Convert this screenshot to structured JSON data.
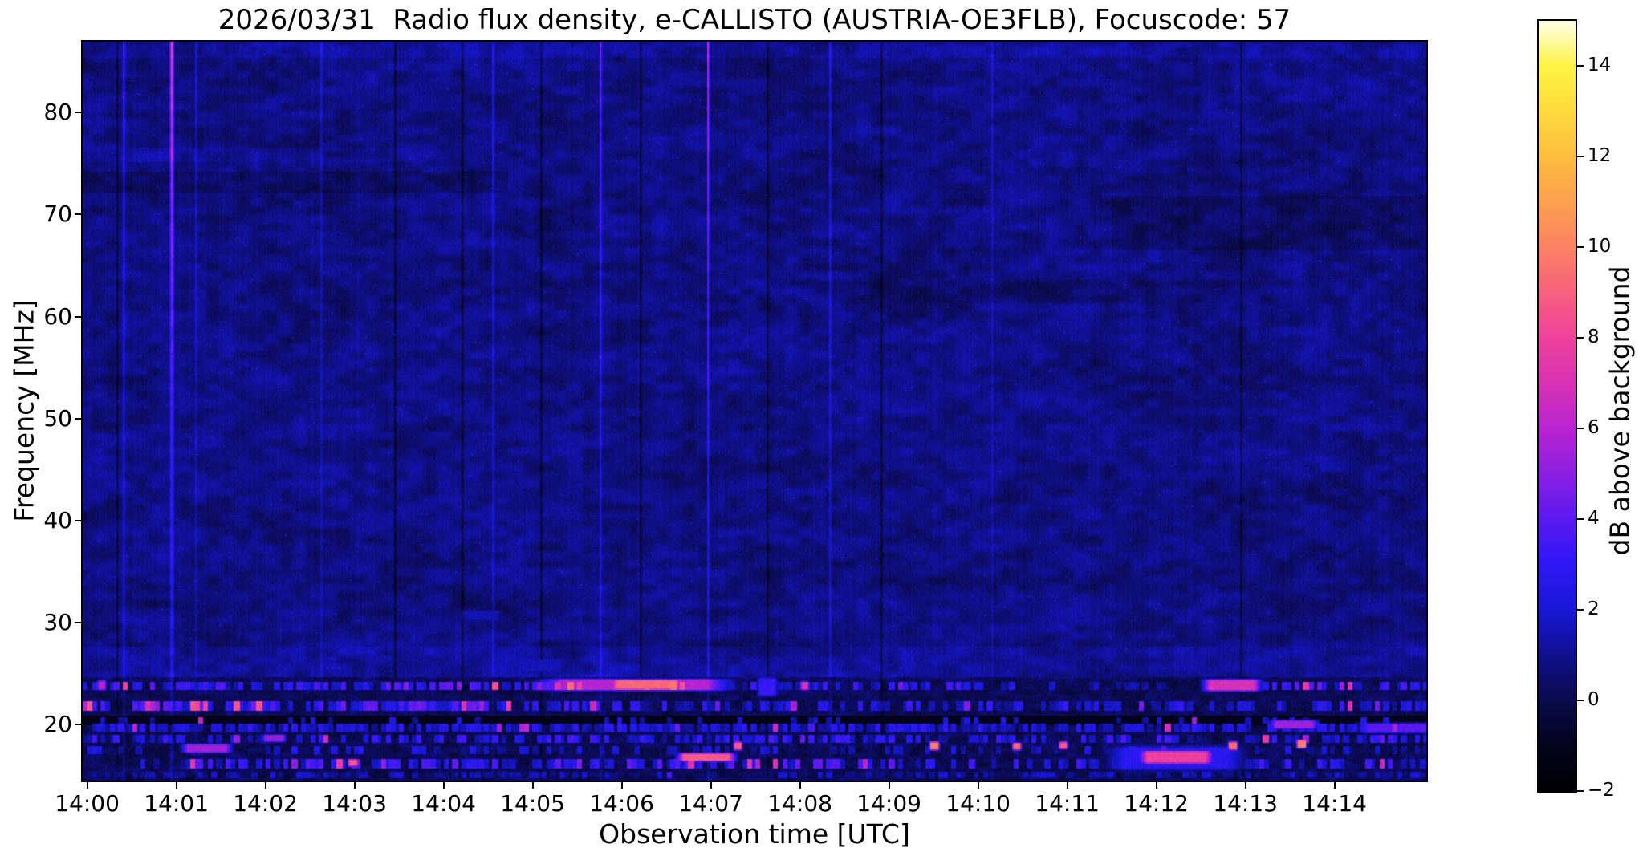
{
  "chart_data": {
    "type": "heatmap",
    "title": "2026/03/31  Radio flux density, e-CALLISTO (AUSTRIA-OE3FLB), Focuscode: 57",
    "xlabel": "Observation time [UTC]",
    "ylabel": "Frequency [MHz]",
    "colorbar_label": "dB above background",
    "x_tick_labels": [
      "14:00",
      "14:01",
      "14:02",
      "14:03",
      "14:04",
      "14:05",
      "14:06",
      "14:07",
      "14:08",
      "14:09",
      "14:10",
      "14:11",
      "14:12",
      "14:13",
      "14:14"
    ],
    "x_tick_minutes": [
      0,
      1,
      2,
      3,
      4,
      5,
      6,
      7,
      8,
      9,
      10,
      11,
      12,
      13,
      14
    ],
    "x_range_minutes": [
      -0.05,
      15.03
    ],
    "y_ticks_mhz": [
      80,
      70,
      60,
      50,
      40,
      30,
      20
    ],
    "y_range_mhz": [
      14.5,
      86.95
    ],
    "grid": false,
    "colorbar": {
      "ticks": [
        14,
        12,
        10,
        8,
        6,
        4,
        2,
        0,
        -2
      ],
      "range": [
        -2,
        15
      ],
      "stops": [
        [
          -2,
          "#000000"
        ],
        [
          -1,
          "#03031d"
        ],
        [
          0,
          "#0a0a4a"
        ],
        [
          1,
          "#10108e"
        ],
        [
          2,
          "#1717d6"
        ],
        [
          3,
          "#2e18f5"
        ],
        [
          4,
          "#5a19f0"
        ],
        [
          5,
          "#8a1fe2"
        ],
        [
          6,
          "#b724cf"
        ],
        [
          7,
          "#d832b4"
        ],
        [
          8,
          "#ef419c"
        ],
        [
          9,
          "#f7617e"
        ],
        [
          10,
          "#fb8163"
        ],
        [
          11,
          "#fca04e"
        ],
        [
          12,
          "#fdbd3e"
        ],
        [
          13,
          "#fdda3d"
        ],
        [
          14,
          "#fdf442"
        ],
        [
          15,
          "#ffffe8"
        ]
      ]
    },
    "background": {
      "base_db": 0.82,
      "low_band_top_mhz": 24.6,
      "low_base_db": 0.18
    },
    "stripes": [
      {
        "t0": -0.05,
        "t1": 15.03,
        "f0": 85.6,
        "f1": 86.95,
        "dv": 0.35
      },
      {
        "t0": -0.05,
        "t1": 4.7,
        "f0": 72.3,
        "f1": 74.2,
        "dv": -0.45
      },
      {
        "t0": -0.05,
        "t1": 3.6,
        "f0": 75.3,
        "f1": 76.6,
        "dv": 0.3
      },
      {
        "t0": 11.5,
        "t1": 15.03,
        "f0": 66.6,
        "f1": 71.9,
        "dv": -0.4
      },
      {
        "t0": 8.0,
        "t1": 15.03,
        "f0": 61.5,
        "f1": 63.5,
        "dv": -0.22
      },
      {
        "t0": -0.05,
        "t1": 15.03,
        "f0": 24.6,
        "f1": 27.6,
        "dv": 0.3
      }
    ],
    "vertical_streaks": [
      {
        "t": 0.4,
        "w": 2,
        "top": 2.6,
        "bot": 1.3
      },
      {
        "t": 0.94,
        "w": 3,
        "top": 7.2,
        "bot": 1.8
      },
      {
        "t": 1.22,
        "w": 2,
        "top": 1.5,
        "bot": 0.8
      },
      {
        "t": 2.62,
        "w": 2,
        "top": 1.3,
        "bot": 0.7
      },
      {
        "t": 4.55,
        "w": 2,
        "top": 1.6,
        "bot": 0.8
      },
      {
        "t": 5.75,
        "w": 2,
        "top": 3.6,
        "bot": 1.5
      },
      {
        "t": 6.95,
        "w": 2,
        "top": 5.2,
        "bot": 1.6
      },
      {
        "t": 8.32,
        "w": 2,
        "top": 1.7,
        "bot": 0.9
      },
      {
        "t": 10.15,
        "w": 2,
        "top": 1.2,
        "bot": 0.7
      }
    ],
    "dark_vertical_lines": [
      {
        "t": 0.32
      },
      {
        "t": 3.45
      },
      {
        "t": 4.2
      },
      {
        "t": 5.08
      },
      {
        "t": 6.2
      },
      {
        "t": 7.62
      },
      {
        "t": 8.9
      },
      {
        "t": 12.94
      }
    ],
    "band_rows": [
      {
        "f": 23.85,
        "h": 9,
        "segs": [
          [
            -0.05,
            5.0,
            0.6,
            1.5,
            4.2,
            0.08
          ],
          [
            5.0,
            6.9,
            0.85,
            2.5,
            5.5,
            0.3
          ],
          [
            6.9,
            9.9,
            0.5,
            1.2,
            3.6,
            0.05
          ],
          [
            9.9,
            12.45,
            0.28,
            0.8,
            2.8,
            0.03
          ],
          [
            12.45,
            15.03,
            0.6,
            1.5,
            4.2,
            0.12
          ]
        ]
      },
      {
        "f": 21.9,
        "h": 9,
        "segs": [
          [
            -0.05,
            4.7,
            0.85,
            1.8,
            4.6,
            0.18
          ],
          [
            4.7,
            15.03,
            0.5,
            1.0,
            3.2,
            0.06
          ]
        ]
      },
      {
        "f": 20.5,
        "h": 9,
        "type": "dark",
        "segs": []
      },
      {
        "f": 20.5,
        "h": 7,
        "segs": [
          [
            -0.05,
            15.03,
            0.13,
            1.0,
            2.6,
            0.02
          ]
        ]
      },
      {
        "f": 19.8,
        "h": 8,
        "segs": [
          [
            -0.05,
            15.03,
            0.8,
            1.0,
            3.2,
            0.04
          ]
        ]
      },
      {
        "f": 18.65,
        "h": 9,
        "segs": [
          [
            -0.05,
            15.03,
            0.5,
            1.0,
            3.6,
            0.06
          ]
        ]
      },
      {
        "f": 17.5,
        "h": 8,
        "segs": [
          [
            -0.05,
            15.03,
            0.3,
            0.8,
            2.6,
            0.04
          ]
        ]
      },
      {
        "f": 16.25,
        "h": 9,
        "segs": [
          [
            -0.05,
            1.2,
            0.35,
            1.0,
            3.0,
            0.05
          ],
          [
            1.2,
            10.0,
            0.55,
            1.4,
            4.2,
            0.1
          ],
          [
            10.0,
            15.03,
            0.5,
            1.2,
            3.6,
            0.08
          ]
        ]
      },
      {
        "f": 15.15,
        "h": 7,
        "segs": [
          [
            -0.05,
            15.03,
            0.5,
            0.7,
            2.2,
            0.02
          ]
        ]
      }
    ],
    "events": [
      {
        "t0": 5.35,
        "t1": 6.95,
        "f0": 23.45,
        "f1": 24.35,
        "v": 6.0
      },
      {
        "t0": 5.95,
        "t1": 6.6,
        "f0": 23.5,
        "f1": 24.3,
        "v": 9.2
      },
      {
        "t0": 12.6,
        "t1": 13.1,
        "f0": 23.4,
        "f1": 24.3,
        "v": 7.0
      },
      {
        "t0": 8.02,
        "t1": 8.09,
        "f0": 23.5,
        "f1": 24.1,
        "v": 7.0
      },
      {
        "t0": 7.55,
        "t1": 7.72,
        "f0": 23.0,
        "f1": 24.4,
        "v": 3.2
      },
      {
        "t0": 0.13,
        "t1": 0.2,
        "f0": 23.5,
        "f1": 24.2,
        "v": 6.0
      },
      {
        "t0": 2.0,
        "t1": 2.2,
        "f0": 18.4,
        "f1": 18.9,
        "v": 5.2
      },
      {
        "t0": 6.7,
        "t1": 7.2,
        "f0": 16.5,
        "f1": 17.1,
        "v": 8.8
      },
      {
        "t0": 11.9,
        "t1": 12.55,
        "f0": 16.3,
        "f1": 17.3,
        "v": 8.0
      },
      {
        "t0": 11.65,
        "t1": 12.8,
        "f0": 15.8,
        "f1": 17.6,
        "v": 2.8
      },
      {
        "t0": 1.13,
        "t1": 1.56,
        "f0": 17.35,
        "f1": 17.95,
        "v": 5.5
      },
      {
        "t0": 13.34,
        "t1": 13.75,
        "f0": 19.7,
        "f1": 20.3,
        "v": 5.5
      },
      {
        "t0": 14.38,
        "t1": 15.03,
        "f0": 19.3,
        "f1": 20.0,
        "v": 4.0
      },
      {
        "t0": 2.94,
        "t1": 3.03,
        "f0": 16.0,
        "f1": 16.5,
        "v": 8.6
      },
      {
        "t0": 7.27,
        "t1": 7.34,
        "f0": 17.6,
        "f1": 18.2,
        "v": 8.8
      },
      {
        "t0": 9.47,
        "t1": 9.55,
        "f0": 17.6,
        "f1": 18.2,
        "v": 10.0
      },
      {
        "t0": 10.4,
        "t1": 10.47,
        "f0": 17.6,
        "f1": 18.1,
        "v": 9.3
      },
      {
        "t0": 10.92,
        "t1": 10.99,
        "f0": 17.7,
        "f1": 18.2,
        "v": 8.8
      },
      {
        "t0": 12.82,
        "t1": 12.9,
        "f0": 17.6,
        "f1": 18.2,
        "v": 9.5
      },
      {
        "t0": 13.59,
        "t1": 13.67,
        "f0": 17.8,
        "f1": 18.4,
        "v": 10.0
      },
      {
        "t0": 4.85,
        "t1": 5.3,
        "f0": 25.3,
        "f1": 26.3,
        "v": 1.6
      },
      {
        "t0": 4.25,
        "t1": 4.6,
        "f0": 30.3,
        "f1": 31.1,
        "v": 1.5
      }
    ]
  }
}
